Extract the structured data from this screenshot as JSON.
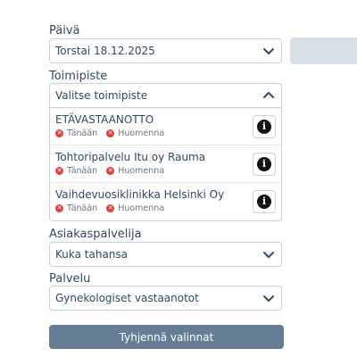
{
  "date": {
    "label": "Päivä",
    "value": "Torstai 18.12.2025"
  },
  "office": {
    "label": "Toimipiste",
    "placeholder": "Valitse toimipiste",
    "items": [
      {
        "name": "ETÄVASTAANOTTO",
        "today": "Tänään",
        "tomorrow": "Huomenna"
      },
      {
        "name": "Tohtoripalvelu Itu oy Rauma",
        "today": "Tänään",
        "tomorrow": "Huomenna"
      },
      {
        "name": "Vaihdevuosiklinikka Helsinki Oy",
        "today": "Tänään",
        "tomorrow": "Huomenna"
      }
    ]
  },
  "staff": {
    "label": "Asiakaspalvelija",
    "value": "Kuka tahansa"
  },
  "service": {
    "label": "Palvelu",
    "value": "Gynekologiset vastaanotot"
  },
  "clear_button": "Tyhjennä valinnat",
  "colors": {
    "accent": "#667e95",
    "error": "#e0403a",
    "text": "#2f4a66"
  }
}
